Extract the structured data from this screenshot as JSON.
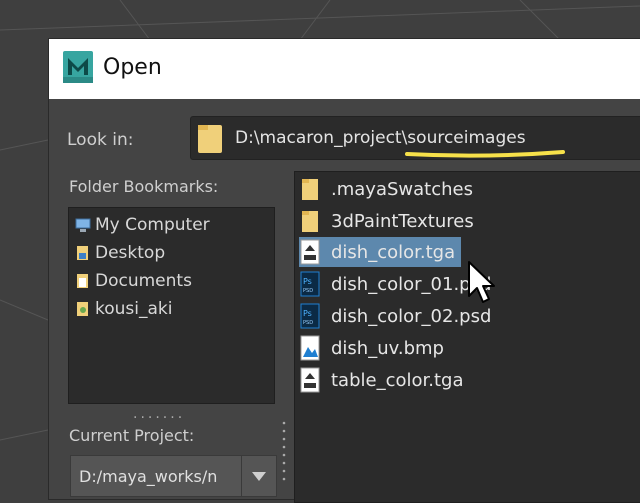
{
  "dialog": {
    "title": "Open",
    "app_icon": "maya-logo-icon",
    "look_in": {
      "label": "Look in:",
      "path": "D:\\macaron_project\\sourceimages"
    },
    "bookmarks": {
      "label": "Folder Bookmarks:",
      "items": [
        {
          "label": "My Computer",
          "icon": "computer-icon"
        },
        {
          "label": "Desktop",
          "icon": "desktop-icon"
        },
        {
          "label": "Documents",
          "icon": "documents-icon"
        },
        {
          "label": "kousi_aki",
          "icon": "user-folder-icon"
        }
      ]
    },
    "current_project": {
      "label": "Current Project:",
      "value": "D:/maya_works/n"
    },
    "files": [
      {
        "label": ".mayaSwatches",
        "icon": "folder-icon"
      },
      {
        "label": "3dPaintTextures",
        "icon": "folder-icon"
      },
      {
        "label": "dish_color.tga",
        "icon": "tga-file-icon",
        "selected": true
      },
      {
        "label": "dish_color_01.psd",
        "icon": "psd-file-icon"
      },
      {
        "label": "dish_color_02.psd",
        "icon": "psd-file-icon"
      },
      {
        "label": "dish_uv.bmp",
        "icon": "bmp-file-icon"
      },
      {
        "label": "table_color.tga",
        "icon": "tga-file-icon"
      }
    ]
  },
  "colors": {
    "selection": "#5d88ad",
    "highlight_underline": "#f7e14a",
    "folder": "#e8c66a",
    "psd_blue": "#1f7fd1"
  }
}
